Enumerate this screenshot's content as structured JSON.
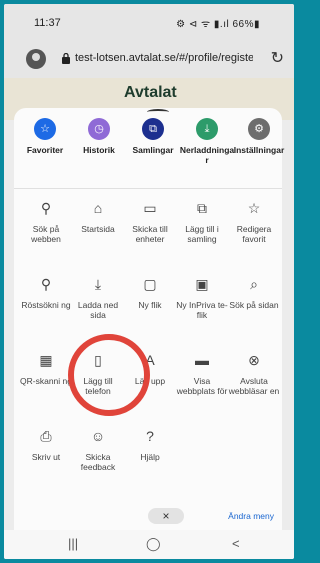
{
  "status": {
    "time": "11:37",
    "right": "⚙ ⊲ ᯤ ▮.ıl 66%▮"
  },
  "browser": {
    "url": "test-lotsen.avtalat.se/#/profile/register",
    "reload_icon": "reload-icon"
  },
  "page": {
    "brand": "Avtalat"
  },
  "menu": {
    "top": [
      {
        "label": "Favoriter",
        "icon": "star-icon",
        "color": "#1d6ae5"
      },
      {
        "label": "Historik",
        "icon": "history-icon",
        "color": "#8f6ad6"
      },
      {
        "label": "Samlingar",
        "icon": "collections-icon",
        "color": "#1c2f8f"
      },
      {
        "label": "Nerladdninga r",
        "icon": "download-icon",
        "color": "#2d9b6a"
      },
      {
        "label": "Inställningar",
        "icon": "settings-icon",
        "color": "#6d6d6d"
      }
    ],
    "rows": [
      [
        {
          "label": "Sök på webben",
          "icon": "search-icon"
        },
        {
          "label": "Startsida",
          "icon": "home-icon"
        },
        {
          "label": "Skicka till enheter",
          "icon": "send-devices-icon"
        },
        {
          "label": "Lägg till i samling",
          "icon": "add-collection-icon"
        },
        {
          "label": "Redigera favorit",
          "icon": "edit-favorite-icon"
        }
      ],
      [
        {
          "label": "Röstsökni ng",
          "icon": "microphone-icon"
        },
        {
          "label": "Ladda ned sida",
          "icon": "download-page-icon"
        },
        {
          "label": "Ny flik",
          "icon": "new-tab-icon"
        },
        {
          "label": "Ny InPriva te-flik",
          "icon": "inprivate-tab-icon"
        },
        {
          "label": "Sök på sidan",
          "icon": "find-on-page-icon"
        }
      ],
      [
        {
          "label": "QR-skanni ng",
          "icon": "qr-icon"
        },
        {
          "label": "Lägg till telefon",
          "icon": "add-phone-icon"
        },
        {
          "label": "Läs upp",
          "icon": "read-aloud-icon"
        },
        {
          "label": "Visa webbplats för",
          "icon": "view-site-icon"
        },
        {
          "label": "Avsluta webbläsar en",
          "icon": "exit-browser-icon"
        }
      ],
      [
        {
          "label": "Skriv ut",
          "icon": "print-icon"
        },
        {
          "label": "Skicka feedback",
          "icon": "feedback-icon"
        },
        {
          "label": "Hjälp",
          "icon": "help-icon"
        }
      ]
    ],
    "close_label": "×",
    "edit_label": "Ändra meny"
  },
  "nav": {
    "recent": "|||",
    "home": "◯",
    "back": "<"
  }
}
